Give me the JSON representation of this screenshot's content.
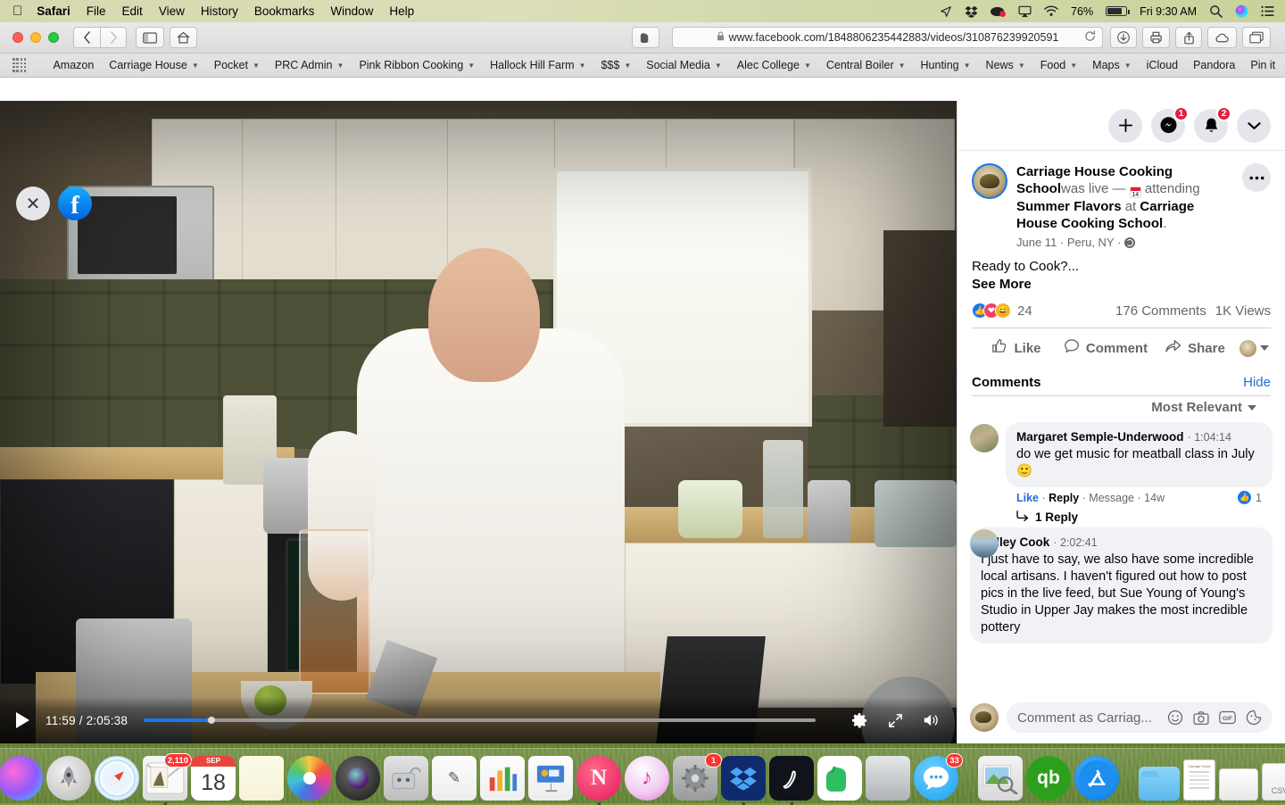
{
  "menubar": {
    "apple_icon": "apple-icon",
    "items": [
      "Safari",
      "File",
      "Edit",
      "View",
      "History",
      "Bookmarks",
      "Window",
      "Help"
    ],
    "status_icons": [
      "location-arrow-icon",
      "dropbox-icon",
      "record-icon",
      "airplay-icon",
      "wifi-icon"
    ],
    "battery_percent": "76%",
    "clock": "Fri 9:30 AM",
    "right_icons": [
      "search-icon",
      "siri-icon",
      "control-center-icon"
    ]
  },
  "browser": {
    "nav_back": "‹",
    "nav_forward": "›",
    "sidebar_icon": "sidebar-icon",
    "home_icon": "home-icon",
    "evernote_icon": "evernote-icon",
    "url": "www.facebook.com/1848806235442883/videos/310876239920591",
    "lock_icon": "lock-icon",
    "reload_icon": "reload-icon",
    "download_icon": "download-icon",
    "print_icon": "print-icon",
    "share_icon": "share-icon",
    "cloud_icon": "cloud-icon",
    "tabs_icon": "tabs-icon",
    "bookmarks": [
      {
        "label": "Amazon",
        "has_arrow": false
      },
      {
        "label": "Carriage House",
        "has_arrow": true
      },
      {
        "label": "Pocket",
        "has_arrow": true
      },
      {
        "label": "PRC Admin",
        "has_arrow": true
      },
      {
        "label": "Pink Ribbon Cooking",
        "has_arrow": true
      },
      {
        "label": "Hallock Hill Farm",
        "has_arrow": true
      },
      {
        "label": "$$$",
        "has_arrow": true
      },
      {
        "label": "Social Media",
        "has_arrow": true
      },
      {
        "label": "Alec College",
        "has_arrow": true
      },
      {
        "label": "Central Boiler",
        "has_arrow": true
      },
      {
        "label": "Hunting",
        "has_arrow": true
      },
      {
        "label": "News",
        "has_arrow": true
      },
      {
        "label": "Food",
        "has_arrow": true
      },
      {
        "label": "Maps",
        "has_arrow": true
      },
      {
        "label": "iCloud",
        "has_arrow": false
      },
      {
        "label": "Pandora",
        "has_arrow": false
      },
      {
        "label": "Pin it",
        "has_arrow": false
      }
    ],
    "add_tab_label": "+"
  },
  "video": {
    "close_label": "✕",
    "facebook_label": "f",
    "play_icon": "play-icon",
    "current_time": "11:59",
    "duration": "2:05:38",
    "time_display": "11:59 / 2:05:38",
    "progress_percent": 9.5,
    "settings_icon": "gear-icon",
    "fullscreen_icon": "fullscreen-icon",
    "volume_icon": "volume-icon"
  },
  "panel": {
    "top_actions": [
      {
        "name": "create-button",
        "label": "+",
        "badge": null
      },
      {
        "name": "messenger-button",
        "label": "messenger-icon",
        "badge": "1"
      },
      {
        "name": "notifications-button",
        "label": "bell-icon",
        "badge": "2"
      },
      {
        "name": "account-button",
        "label": "chevron-down-icon",
        "badge": null
      }
    ],
    "post": {
      "page_name": "Carriage House Cooking School",
      "was_live": "was live — ",
      "attending": " attending ",
      "event_name": "Summer Flavors",
      "at_word": " at ",
      "venue": "Carriage House Cooking School",
      "period": ".",
      "date": "June 11",
      "location": "Peru, NY",
      "privacy_icon": "globe-icon",
      "menu_icon": "ellipsis-icon",
      "body_text": "Ready to Cook?...",
      "see_more": "See More",
      "reactions": [
        "like",
        "love",
        "haha"
      ],
      "reaction_count": "24",
      "comments_count": "176 Comments",
      "views_count": "1K Views",
      "actions": [
        {
          "name": "like-button",
          "label": "Like",
          "icon": "thumbs-up-icon"
        },
        {
          "name": "comment-button",
          "label": "Comment",
          "icon": "comment-bubble-icon"
        },
        {
          "name": "share-button",
          "label": "Share",
          "icon": "share-arrow-icon"
        }
      ]
    },
    "comments_section": {
      "title": "Comments",
      "hide_label": "Hide",
      "sort_label": "Most Relevant",
      "sort_caret": "chevron-down-icon",
      "items": [
        {
          "author": "Margaret Semple-Underwood",
          "timestamp": "1:04:14",
          "text": "do we get music for meatball class in July 🙂",
          "meta": [
            "Like",
            "Reply",
            "Message",
            "14w"
          ],
          "like_count": "1",
          "replies_label": "1 Reply"
        },
        {
          "author": "Kelley Cook",
          "timestamp": "2:02:41",
          "text": "I just have to say, we also have some incredible local artisans. I haven't figured out how to post pics in the live feed, but Sue Young of Young's Studio in Upper Jay makes the most incredible pottery"
        }
      ]
    },
    "composer": {
      "placeholder": "Comment as Carriag...",
      "icons": [
        "emoji-icon",
        "camera-icon",
        "gif-icon",
        "sticker-icon"
      ]
    }
  },
  "dock": {
    "items": [
      {
        "name": "finder",
        "class": "d-finder",
        "glyph": "",
        "running": true,
        "badge": null
      },
      {
        "name": "dashboard",
        "class": "d-launchpad",
        "glyph": "◍",
        "running": false,
        "badge": null
      },
      {
        "name": "siri",
        "class": "d-siri",
        "glyph": "",
        "running": false,
        "badge": null
      },
      {
        "name": "launchpad",
        "class": "d-rocket",
        "glyph": "🚀",
        "running": false,
        "badge": null
      },
      {
        "name": "safari",
        "class": "d-safari",
        "glyph": "🧭",
        "running": true,
        "badge": null
      },
      {
        "name": "mail",
        "class": "d-mail",
        "glyph": "✉",
        "running": true,
        "badge": "2,110"
      },
      {
        "name": "calendar",
        "class": "d-cal",
        "glyph": "",
        "running": false,
        "badge": null,
        "month": "SEP",
        "day": "18"
      },
      {
        "name": "notes",
        "class": "d-notes",
        "glyph": "",
        "running": false,
        "badge": null
      },
      {
        "name": "photos",
        "class": "d-photos",
        "glyph": "",
        "running": false,
        "badge": null
      },
      {
        "name": "camera",
        "class": "d-camera",
        "glyph": "",
        "running": false,
        "badge": null
      },
      {
        "name": "image-capture",
        "class": "d-imagecap",
        "glyph": "⚕",
        "running": false,
        "badge": null
      },
      {
        "name": "pages",
        "class": "d-pages",
        "glyph": "",
        "running": false,
        "badge": null
      },
      {
        "name": "numbers",
        "class": "d-numbers",
        "glyph": "",
        "running": false,
        "badge": null
      },
      {
        "name": "keynote",
        "class": "d-keynote",
        "glyph": "",
        "running": false,
        "badge": null
      },
      {
        "name": "news",
        "class": "d-news",
        "glyph": "N",
        "running": true,
        "badge": null
      },
      {
        "name": "itunes",
        "class": "d-itunes",
        "glyph": "♪",
        "running": false,
        "badge": null
      },
      {
        "name": "system-preferences",
        "class": "d-sysprefs",
        "glyph": "⚙",
        "running": false,
        "badge": "1"
      },
      {
        "name": "dropbox",
        "class": "d-dropbox",
        "glyph": "❖",
        "running": true,
        "badge": null
      },
      {
        "name": "adobe-acrobat",
        "class": "d-acrobat",
        "glyph": "A",
        "running": true,
        "badge": null
      },
      {
        "name": "evernote",
        "class": "d-evernote",
        "glyph": "🐘",
        "running": false,
        "badge": null
      },
      {
        "name": "stove-app",
        "class": "d-stove",
        "glyph": "",
        "running": false,
        "badge": null
      },
      {
        "name": "messages",
        "class": "d-messages",
        "glyph": "💬",
        "running": false,
        "badge": "33"
      },
      {
        "name": "preview",
        "class": "d-preview",
        "glyph": "🔍",
        "running": false,
        "badge": null
      },
      {
        "name": "quickbooks",
        "class": "d-qb",
        "glyph": "qb",
        "running": false,
        "badge": null
      },
      {
        "name": "app-store",
        "class": "d-appstore",
        "glyph": "A",
        "running": false,
        "badge": null
      },
      {
        "name": "downloads-folder",
        "class": "d-folder",
        "glyph": "",
        "running": false,
        "badge": null
      },
      {
        "name": "document-file",
        "class": "d-doc",
        "glyph": "",
        "running": false,
        "badge": null
      },
      {
        "name": "documents-stack",
        "class": "d-stack",
        "glyph": "",
        "running": false,
        "badge": null
      },
      {
        "name": "csv-file",
        "class": "d-csv",
        "glyph": "CSV",
        "running": false,
        "badge": null
      },
      {
        "name": "image-file",
        "class": "d-img",
        "glyph": "",
        "running": false,
        "badge": null
      },
      {
        "name": "trash",
        "class": "d-trash",
        "glyph": "",
        "running": false,
        "badge": null
      }
    ]
  }
}
